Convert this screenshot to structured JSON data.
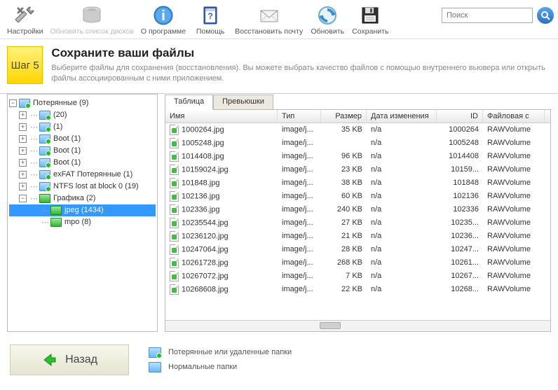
{
  "toolbar": {
    "settings": "Настройки",
    "refresh_disks": "Обновить список дисков",
    "about": "О программе",
    "help": "Помощь",
    "restore_mail": "Восстановить почту",
    "refresh": "Обновить",
    "save": "Сохранить",
    "search_placeholder": "Поиск"
  },
  "header": {
    "step": "Шаг 5",
    "title": "Сохраните ваши файлы",
    "subtitle": "Выберите файлы для сохранения (восстановления). Вы можете выбрать качество файлов с помощью внутреннего вьювера или открыть файлы ассоциированным с ними приложением."
  },
  "tree": {
    "root": "Потерянные (9)",
    "items": [
      " (20)",
      " (1)",
      "Boot (1)",
      "Boot (1)",
      "Boot (1)",
      "exFAT Потерянные (1)",
      "NTFS lost at block 0 (19)",
      "Графика (2)"
    ],
    "gfx_children": [
      "jpeg (1434)",
      "mpo (8)"
    ]
  },
  "tabs": {
    "table": "Таблица",
    "thumbs": "Превьюшки"
  },
  "columns": [
    "Имя",
    "Тип",
    "Размер",
    "Дата изменения",
    "ID",
    "Файловая с"
  ],
  "rows": [
    {
      "name": "1000264.jpg",
      "type": "image/j...",
      "size": "35 KB",
      "date": "n/a",
      "id": "1000264",
      "fs": "RAWVolume"
    },
    {
      "name": "1005248.jpg",
      "type": "image/j...",
      "size": "",
      "date": "n/a",
      "id": "1005248",
      "fs": "RAWVolume"
    },
    {
      "name": "1014408.jpg",
      "type": "image/j...",
      "size": "96 KB",
      "date": "n/a",
      "id": "1014408",
      "fs": "RAWVolume"
    },
    {
      "name": "10159024.jpg",
      "type": "image/j...",
      "size": "23 KB",
      "date": "n/a",
      "id": "10159...",
      "fs": "RAWVolume"
    },
    {
      "name": "101848.jpg",
      "type": "image/j...",
      "size": "38 KB",
      "date": "n/a",
      "id": "101848",
      "fs": "RAWVolume"
    },
    {
      "name": "102136.jpg",
      "type": "image/j...",
      "size": "60 KB",
      "date": "n/a",
      "id": "102136",
      "fs": "RAWVolume"
    },
    {
      "name": "102336.jpg",
      "type": "image/j...",
      "size": "240 KB",
      "date": "n/a",
      "id": "102336",
      "fs": "RAWVolume"
    },
    {
      "name": "10235544.jpg",
      "type": "image/j...",
      "size": "27 KB",
      "date": "n/a",
      "id": "10235...",
      "fs": "RAWVolume"
    },
    {
      "name": "10236120.jpg",
      "type": "image/j...",
      "size": "21 KB",
      "date": "n/a",
      "id": "10236...",
      "fs": "RAWVolume"
    },
    {
      "name": "10247064.jpg",
      "type": "image/j...",
      "size": "28 KB",
      "date": "n/a",
      "id": "10247...",
      "fs": "RAWVolume"
    },
    {
      "name": "10261728.jpg",
      "type": "image/j...",
      "size": "268 KB",
      "date": "n/a",
      "id": "10261...",
      "fs": "RAWVolume"
    },
    {
      "name": "10267072.jpg",
      "type": "image/j...",
      "size": "7 KB",
      "date": "n/a",
      "id": "10267...",
      "fs": "RAWVolume"
    },
    {
      "name": "10268608.jpg",
      "type": "image/j...",
      "size": "22 KB",
      "date": "n/a",
      "id": "10268...",
      "fs": "RAWVolume"
    }
  ],
  "footer": {
    "back": "Назад",
    "legend_lost": "Потерянные или удаленные папки",
    "legend_normal": "Нормальные папки"
  }
}
